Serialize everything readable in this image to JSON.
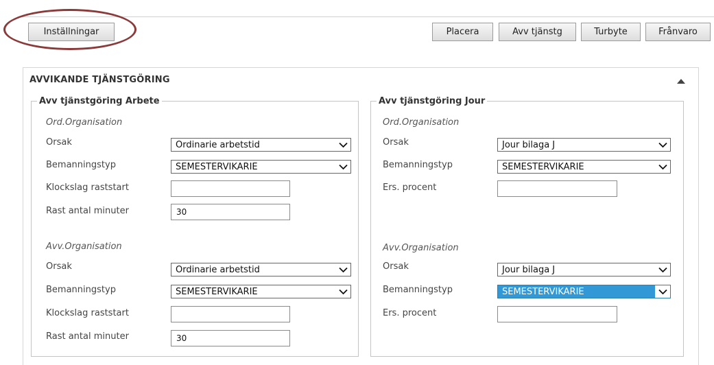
{
  "toolbar": {
    "settings_label": "Inställningar",
    "placera_label": "Placera",
    "avv_tjanstg_label": "Avv tjänstg",
    "turbyte_label": "Turbyte",
    "franvaro_label": "Frånvaro"
  },
  "panel": {
    "title": "AVVIKANDE TJÄNSTGÖRING"
  },
  "arbete": {
    "legend": "Avv tjänstgöring Arbete",
    "ord": {
      "heading": "Ord.Organisation",
      "orsak_label": "Orsak",
      "orsak_value": "Ordinarie arbetstid",
      "bemanning_label": "Bemanningstyp",
      "bemanning_value": "SEMESTERVIKARIE",
      "klockslag_label": "Klockslag raststart",
      "klockslag_value": "",
      "rast_label": "Rast antal minuter",
      "rast_value": "30"
    },
    "avv": {
      "heading": "Avv.Organisation",
      "orsak_label": "Orsak",
      "orsak_value": "Ordinarie arbetstid",
      "bemanning_label": "Bemanningstyp",
      "bemanning_value": "SEMESTERVIKARIE",
      "klockslag_label": "Klockslag raststart",
      "klockslag_value": "",
      "rast_label": "Rast antal minuter",
      "rast_value": "30"
    }
  },
  "jour": {
    "legend": "Avv tjänstgöring Jour",
    "ord": {
      "heading": "Ord.Organisation",
      "orsak_label": "Orsak",
      "orsak_value": "Jour bilaga J",
      "bemanning_label": "Bemanningstyp",
      "bemanning_value": "SEMESTERVIKARIE",
      "ers_label": "Ers. procent",
      "ers_value": ""
    },
    "avv": {
      "heading": "Avv.Organisation",
      "orsak_label": "Orsak",
      "orsak_value": "Jour bilaga J",
      "bemanning_label": "Bemanningstyp",
      "bemanning_value": "SEMESTERVIKARIE",
      "ers_label": "Ers. procent",
      "ers_value": ""
    }
  },
  "colors": {
    "highlight_circle": "#8b3a3a",
    "selected_option_bg": "#3399d6"
  }
}
